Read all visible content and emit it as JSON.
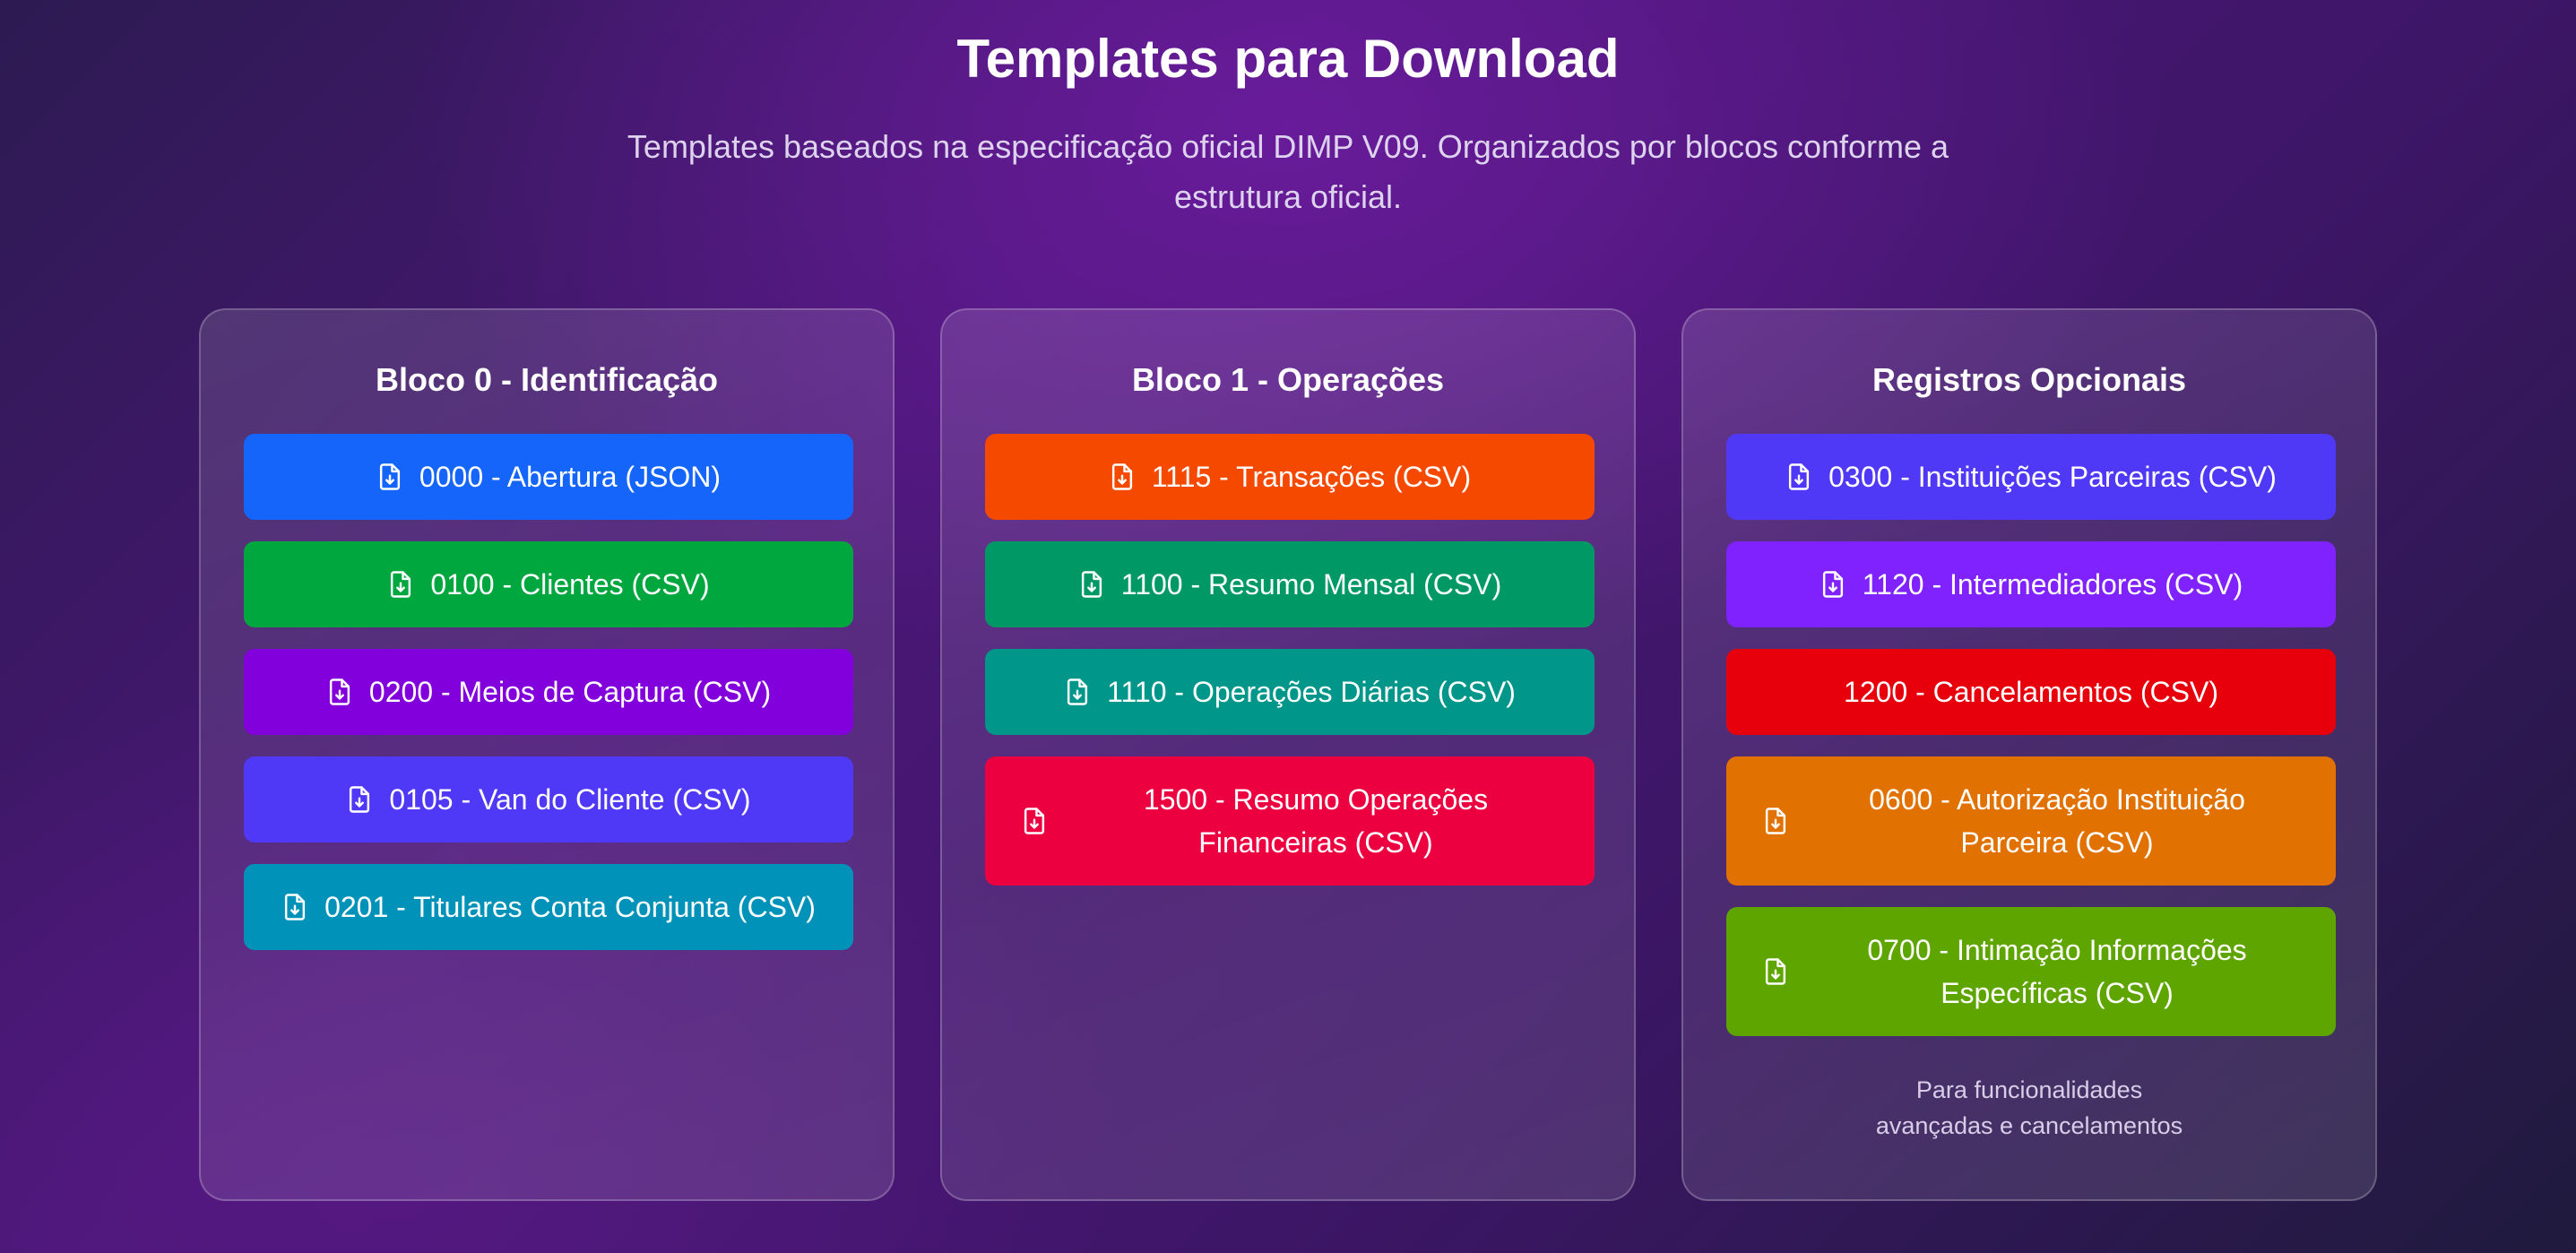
{
  "header": {
    "title": "Templates para Download",
    "subtitle": "Templates baseados na especificação oficial DIMP V09. Organizados por blocos conforme a estrutura oficial."
  },
  "cards": [
    {
      "title": "Bloco 0 - Identificação",
      "buttons": [
        {
          "label": "0000 - Abertura (JSON)",
          "color": "#1565fa",
          "icon": "file-download-icon"
        },
        {
          "label": "0100 - Clientes (CSV)",
          "color": "#00a63e",
          "icon": "file-download-icon"
        },
        {
          "label": "0200 - Meios de Captura (CSV)",
          "color": "#8200db",
          "icon": "file-download-icon"
        },
        {
          "label": "0105 - Van do Cliente (CSV)",
          "color": "#4f39f6",
          "icon": "file-download-icon"
        },
        {
          "label": "0201 - Titulares Conta Conjunta (CSV)",
          "color": "#0092b8",
          "icon": "file-download-icon"
        }
      ]
    },
    {
      "title": "Bloco 1 - Operações",
      "buttons": [
        {
          "label": "1115 - Transações (CSV)",
          "color": "#f54900",
          "icon": "file-download-icon"
        },
        {
          "label": "1100 - Resumo Mensal (CSV)",
          "color": "#009966",
          "icon": "file-download-icon"
        },
        {
          "label": "1110 - Operações Diárias (CSV)",
          "color": "#009689",
          "icon": "file-download-icon"
        },
        {
          "label": "1500 - Resumo Operações Financeiras (CSV)",
          "color": "#ec003f",
          "icon": "file-download-icon"
        }
      ]
    },
    {
      "title": "Registros Opcionais",
      "buttons": [
        {
          "label": "0300 - Instituições Parceiras (CSV)",
          "color": "#4f39f6",
          "icon": "file-download-icon"
        },
        {
          "label": "1120 - Intermediadores (CSV)",
          "color": "#7f22fe",
          "icon": "file-download-icon"
        },
        {
          "label": "1200 - Cancelamentos (CSV)",
          "color": "#e7000b",
          "icon": ""
        },
        {
          "label": "0600 - Autorização Instituição Parceira (CSV)",
          "color": "#e17100",
          "icon": "file-download-icon"
        },
        {
          "label": "0700 - Intimação Informações Específicas (CSV)",
          "color": "#5ea500",
          "icon": "file-download-icon"
        }
      ],
      "note": "Para funcionalidades\navançadas e cancelamentos"
    }
  ]
}
